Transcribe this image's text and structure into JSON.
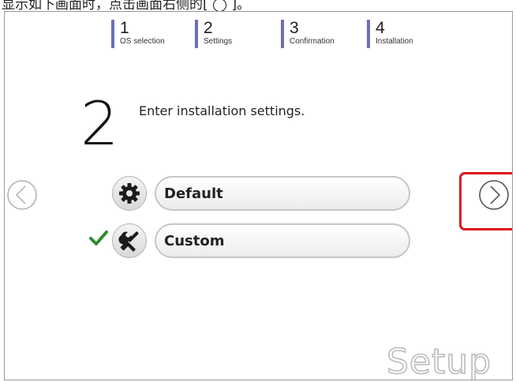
{
  "top_caption": "显示如下画面时，点击画面右侧的[  ◯  ]。",
  "steps": [
    {
      "number": "1",
      "label": "OS selection"
    },
    {
      "number": "2",
      "label": "Settings"
    },
    {
      "number": "3",
      "label": "Confirmation"
    },
    {
      "number": "4",
      "label": "Installation"
    }
  ],
  "current_step": {
    "number": "2",
    "instruction": "Enter installation settings."
  },
  "options": [
    {
      "label": "Default",
      "icon": "gear-icon",
      "selected": false
    },
    {
      "label": "Custom",
      "icon": "wrench-screwdriver-icon",
      "selected": true
    }
  ],
  "navigation": {
    "back_icon": "chevron-left-circle-icon",
    "next_icon": "chevron-right-circle-icon"
  },
  "colors": {
    "step_marker": "#6b6fb8",
    "highlight": "#e0141e",
    "check": "#2e8b2e"
  },
  "brand_text": "Setup"
}
